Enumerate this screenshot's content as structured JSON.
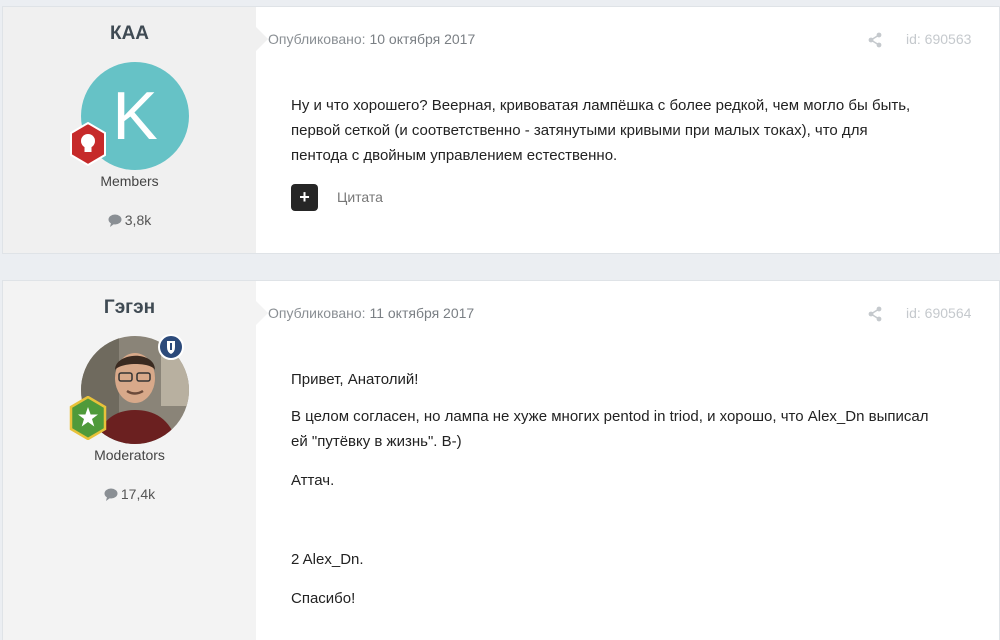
{
  "posts": [
    {
      "author": "КАА",
      "avatar_letter": "K",
      "group": "Members",
      "reputation": "3,8k",
      "date_label": "Опубликовано:",
      "date": "10 октября 2017",
      "id_label": "id: 690563",
      "paragraphs": [
        "Ну и что хорошего? Веерная, кривоватая лампёшка с более редкой, чем могло бы быть,",
        "первой сеткой (и соответственно - затянутыми кривыми при малых токах), что для",
        "пентода с двойным управлением естественно."
      ],
      "quote_label": "Цитата",
      "plus_label": "+",
      "badge_color": "#c62a2a"
    },
    {
      "author": "Гэгэн",
      "group": "Moderators",
      "reputation": "17,4k",
      "date_label": "Опубликовано:",
      "date": "11 октября 2017",
      "id_label": "id: 690564",
      "greeting": "Привет, Анатолий!",
      "body_line1": "В целом согласен, но лампа не хуже многих pentod in triod, и хорошо, что Alex_Dn выписал",
      "body_line2": "ей \"путёвку в жизнь\". В-)",
      "attach": "Аттач.",
      "to_alex": "2 Alex_Dn.",
      "thanks": "Спасибо!",
      "badge_color": "#4f9a3a",
      "mod_badge_color": "#2c4a7a"
    }
  ],
  "colors": {
    "avatar_bg": "#66c2c6",
    "author_panel": "#f0f0f0",
    "page_bg": "#ebeef2"
  }
}
